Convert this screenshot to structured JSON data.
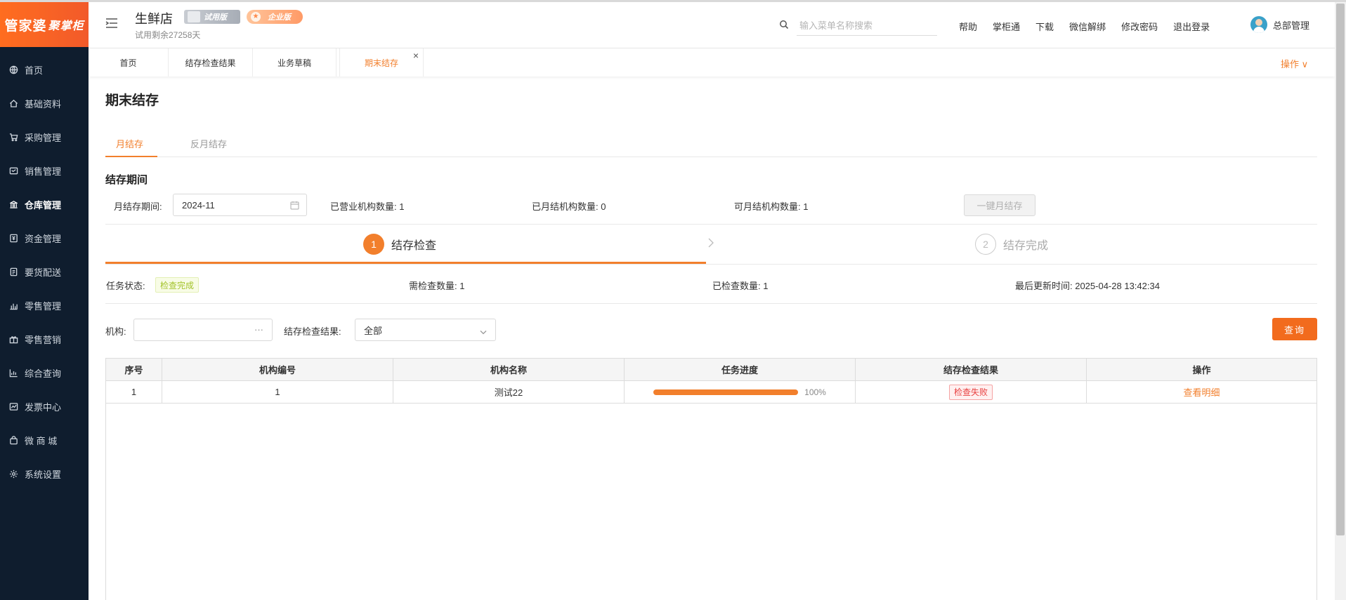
{
  "app": {
    "logo_main": "管家婆",
    "logo_sub": "聚掌柜"
  },
  "sidebar": {
    "items": [
      {
        "label": "首页",
        "icon": "globe-icon",
        "active": false
      },
      {
        "label": "基础资料",
        "icon": "home-icon",
        "active": false
      },
      {
        "label": "采购管理",
        "icon": "cart-icon",
        "active": false
      },
      {
        "label": "销售管理",
        "icon": "sales-icon",
        "active": false
      },
      {
        "label": "仓库管理",
        "icon": "bank-icon",
        "active": true
      },
      {
        "label": "资金管理",
        "icon": "money-icon",
        "active": false
      },
      {
        "label": "要货配送",
        "icon": "document-icon",
        "active": false
      },
      {
        "label": "零售管理",
        "icon": "bar-chart-icon",
        "active": false
      },
      {
        "label": "零售营销",
        "icon": "gift-icon",
        "active": false
      },
      {
        "label": "综合查询",
        "icon": "chart-icon",
        "active": false
      },
      {
        "label": "发票中心",
        "icon": "invoice-icon",
        "active": false
      },
      {
        "label": "微 商 城",
        "icon": "bag-icon",
        "active": false
      },
      {
        "label": "系统设置",
        "icon": "gear-icon",
        "active": false
      }
    ]
  },
  "header": {
    "store_name": "生鲜店",
    "trial_badge": "试用版",
    "enterprise_badge": "企业版",
    "trial_days": "试用剩余27258天",
    "search_placeholder": "输入菜单名称搜索",
    "links": [
      "帮助",
      "掌柜通",
      "下载",
      "微信解绑",
      "修改密码",
      "退出登录"
    ],
    "user_name": "总部管理"
  },
  "tabs": [
    {
      "label": "首页"
    },
    {
      "label": "结存检查结果"
    },
    {
      "label": "业务草稿"
    },
    {
      "label": "期末结存"
    }
  ],
  "tab_close": "×",
  "op_menu": "操作 ∨",
  "page": {
    "title": "期末结存",
    "subtabs": [
      "月结存",
      "反月结存"
    ],
    "section_title": "结存期间",
    "period_label": "月结存期间:",
    "period_value": "2024-11",
    "stats": [
      "已营业机构数量:  1",
      "已月结机构数量:  0",
      "可月结机构数量:  1"
    ],
    "oneclick_button": "一键月结存",
    "steps": [
      {
        "num": "1",
        "label": "结存检查",
        "active": true
      },
      {
        "num": "2",
        "label": "结存完成",
        "active": false
      }
    ],
    "task": {
      "status_label": "任务状态:",
      "status_value": "检查完成",
      "need_check": "需检查数量:  1",
      "checked": "已检查数量:  1",
      "last_update": "最后更新时间:  2025-04-28 13:42:34"
    },
    "filter": {
      "org_label": "机构:",
      "org_dots": "···",
      "result_label": "结存检查结果:",
      "result_value": "全部",
      "query_button": "查询"
    },
    "table": {
      "columns": [
        "序号",
        "机构编号",
        "机构名称",
        "任务进度",
        "结存检查结果",
        "操作"
      ],
      "rows": [
        {
          "index": "1",
          "code": "1",
          "name": "测试22",
          "progress": 100,
          "progress_text": "100%",
          "result": "检查失败",
          "action": "查看明细"
        }
      ]
    }
  },
  "colors": {
    "accent": "#f27f2c",
    "sidebar_bg": "#0f1d2e",
    "fail": "#e84040",
    "success": "#a3c32a"
  }
}
